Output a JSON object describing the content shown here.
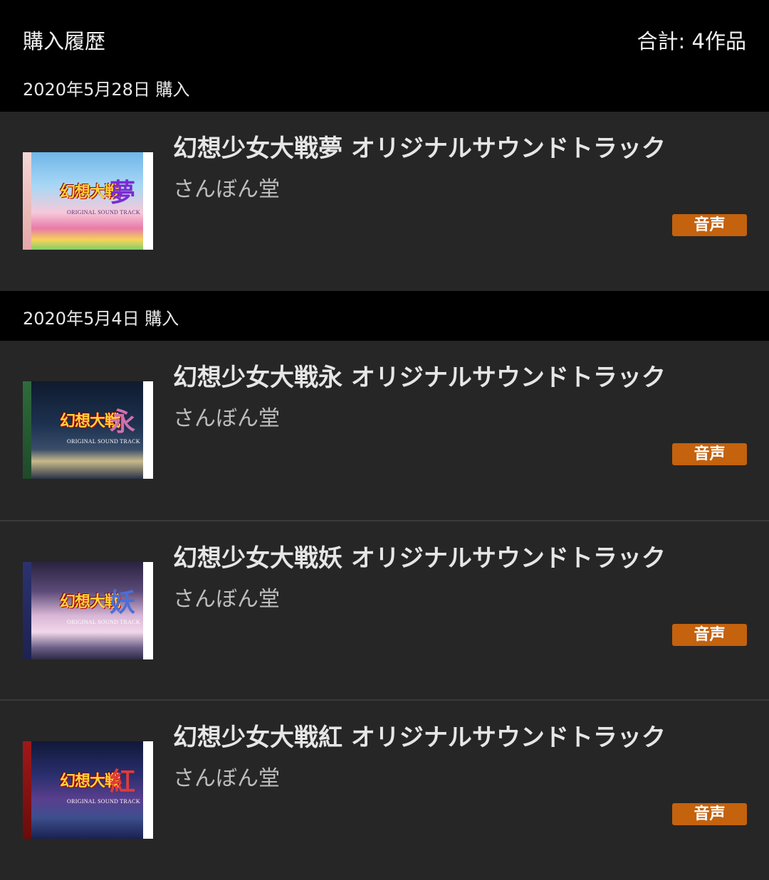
{
  "header": {
    "title": "購入履歴",
    "total": "合計: 4作品"
  },
  "groups": [
    {
      "date": "2020年5月28日 購入",
      "items": [
        {
          "title": "幻想少女大戦夢 オリジナルサウンドトラック",
          "circle": "さんぼん堂",
          "badge": "音声",
          "cover_kanji": "夢",
          "cover_sub": "ORIGINAL SOUND TRACK"
        }
      ]
    },
    {
      "date": "2020年5月4日 購入",
      "items": [
        {
          "title": "幻想少女大戦永 オリジナルサウンドトラック",
          "circle": "さんぼん堂",
          "badge": "音声",
          "cover_kanji": "永",
          "cover_sub": "ORIGINAL SOUND TRACK"
        },
        {
          "title": "幻想少女大戦妖 オリジナルサウンドトラック",
          "circle": "さんぼん堂",
          "badge": "音声",
          "cover_kanji": "妖",
          "cover_sub": "ORIGINAL SOUND TRACK"
        },
        {
          "title": "幻想少女大戦紅 オリジナルサウンドトラック",
          "circle": "さんぼん堂",
          "badge": "音声",
          "cover_kanji": "紅",
          "cover_sub": "ORIGINAL SOUND TRACK"
        }
      ]
    }
  ],
  "colors": {
    "background": "#000000",
    "item_background": "#262626",
    "badge": "#c4620e",
    "title_text": "#e6e6e6",
    "circle_text": "#bdbdbd"
  }
}
